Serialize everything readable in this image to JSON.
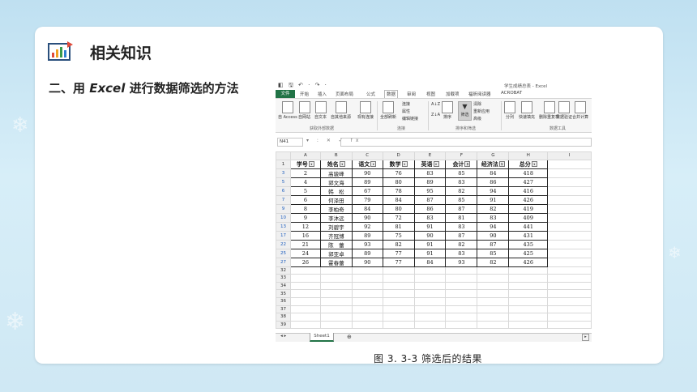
{
  "slide": {
    "section_title": "相关知识",
    "heading_prefix": "二、用 ",
    "heading_excel": "Excel",
    "heading_suffix": " 进行数据筛选的方法",
    "caption": "图 3. 3-3    筛选后的结果"
  },
  "excel": {
    "doc_title": "学生成绩总表 - Excel",
    "quick_access": "◧ 🖫 ↶ · ↷ ·",
    "tabs": [
      "文件",
      "开始",
      "插入",
      "页面布局",
      "公式",
      "数据",
      "审阅",
      "视图",
      "加载项",
      "福昕阅读器",
      "ACROBAT"
    ],
    "active_tab": "数据",
    "ribbon": {
      "from_access": "自 Access",
      "from_web": "自网站",
      "from_text": "自文本",
      "from_other": "自其他来源",
      "existing": "现有连接",
      "refresh_all": "全部刷新",
      "connections": "连接",
      "properties": "属性",
      "edit_links": "编辑链接",
      "sort_asc": "A↓Z",
      "sort_desc": "Z↓A",
      "sort": "排序",
      "filter": "筛选",
      "clear": "清除",
      "reapply": "重新应用",
      "advanced": "高级",
      "text_to_columns": "分列",
      "flash_fill": "快速填充",
      "remove_dup": "删除重复项",
      "validation": "数据验证",
      "consolidate": "合并计算",
      "group_external": "获取外部数据",
      "group_connections": "连接",
      "group_sort_filter": "排序和筛选",
      "group_data_tools": "数据工具"
    },
    "name_box": "N41",
    "fx_symbols": "▾ : ✕ ✓ fx",
    "columns": [
      "A",
      "B",
      "C",
      "D",
      "E",
      "F",
      "G",
      "H",
      "I"
    ],
    "headers": [
      "学号",
      "姓名",
      "语文",
      "数学",
      "英语",
      "会计",
      "经济法",
      "总分"
    ],
    "rows": [
      {
        "r": "3",
        "v": [
          "2",
          "高骏峰",
          "90",
          "76",
          "83",
          "85",
          "84",
          "418"
        ]
      },
      {
        "r": "5",
        "v": [
          "4",
          "郭文海",
          "89",
          "80",
          "89",
          "83",
          "86",
          "427"
        ]
      },
      {
        "r": "6",
        "v": [
          "5",
          "韩　松",
          "67",
          "78",
          "95",
          "82",
          "94",
          "416"
        ]
      },
      {
        "r": "7",
        "v": [
          "6",
          "何泽田",
          "79",
          "84",
          "87",
          "85",
          "91",
          "426"
        ]
      },
      {
        "r": "9",
        "v": [
          "8",
          "李柏奇",
          "84",
          "80",
          "86",
          "87",
          "82",
          "419"
        ]
      },
      {
        "r": "10",
        "v": [
          "9",
          "李沐远",
          "90",
          "72",
          "83",
          "81",
          "83",
          "409"
        ]
      },
      {
        "r": "13",
        "v": [
          "12",
          "刘碧宇",
          "92",
          "81",
          "91",
          "83",
          "94",
          "441"
        ]
      },
      {
        "r": "17",
        "v": [
          "16",
          "齐冠博",
          "89",
          "75",
          "90",
          "87",
          "90",
          "431"
        ]
      },
      {
        "r": "22",
        "v": [
          "21",
          "陈　蕾",
          "93",
          "82",
          "91",
          "82",
          "87",
          "435"
        ]
      },
      {
        "r": "25",
        "v": [
          "24",
          "郭亚卓",
          "89",
          "77",
          "91",
          "83",
          "85",
          "425"
        ]
      },
      {
        "r": "27",
        "v": [
          "26",
          "霍春蕾",
          "90",
          "77",
          "84",
          "93",
          "82",
          "426"
        ]
      }
    ],
    "empty_rows": [
      "32",
      "33",
      "34",
      "35",
      "36",
      "37",
      "38",
      "39"
    ],
    "sheet_tab": "Sheet1",
    "add_sheet": "⊕"
  }
}
